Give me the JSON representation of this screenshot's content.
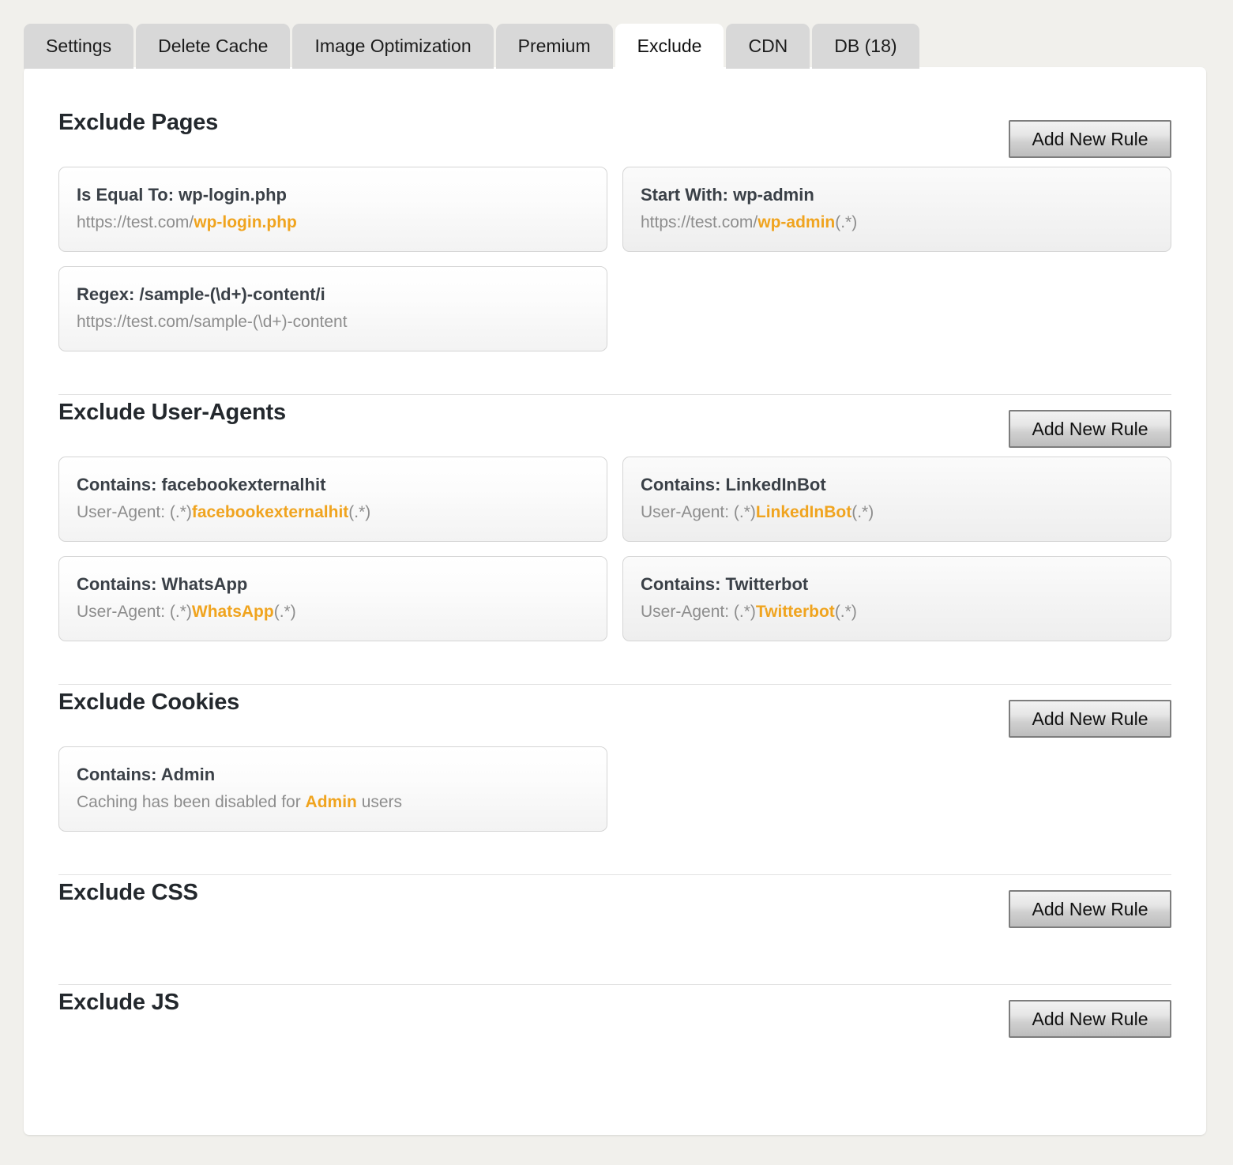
{
  "tabs": [
    {
      "label": "Settings",
      "active": false
    },
    {
      "label": "Delete Cache",
      "active": false
    },
    {
      "label": "Image Optimization",
      "active": false
    },
    {
      "label": "Premium",
      "active": false
    },
    {
      "label": "Exclude",
      "active": true
    },
    {
      "label": "CDN",
      "active": false
    },
    {
      "label": "DB (18)",
      "active": false
    }
  ],
  "colors": {
    "highlight": "#f0a41f",
    "heading": "#23282d",
    "card_title": "#3a4047",
    "card_sub": "#8d8d8d",
    "page_bg": "#f1f0ec",
    "panel_bg": "#ffffff",
    "tab_bg": "#d8d8d8"
  },
  "add_rule_label": "Add New Rule",
  "sections": [
    {
      "id": "exclude-pages",
      "title": "Exclude Pages",
      "button": "Add New Rule",
      "rules": [
        {
          "title": "Is Equal To: wp-login.php",
          "sub_pre": "https://test.com/",
          "sub_hl": "wp-login.php",
          "sub_post": "",
          "shaded": false
        },
        {
          "title": "Start With: wp-admin",
          "sub_pre": "https://test.com/",
          "sub_hl": "wp-admin",
          "sub_post": "(.*)",
          "shaded": true
        },
        {
          "title": "Regex: /sample-(\\d+)-content/i",
          "sub_pre": "https://test.com/sample-(\\d+)-content",
          "sub_hl": "",
          "sub_post": "",
          "shaded": false
        }
      ]
    },
    {
      "id": "exclude-user-agents",
      "title": "Exclude User-Agents",
      "button": "Add New Rule",
      "rules": [
        {
          "title": "Contains: facebookexternalhit",
          "sub_pre": "User-Agent: (.*)",
          "sub_hl": "facebookexternalhit",
          "sub_post": "(.*)",
          "shaded": false
        },
        {
          "title": "Contains: LinkedInBot",
          "sub_pre": "User-Agent: (.*)",
          "sub_hl": "LinkedInBot",
          "sub_post": "(.*)",
          "shaded": true
        },
        {
          "title": "Contains: WhatsApp",
          "sub_pre": "User-Agent: (.*)",
          "sub_hl": "WhatsApp",
          "sub_post": "(.*)",
          "shaded": false
        },
        {
          "title": "Contains: Twitterbot",
          "sub_pre": "User-Agent: (.*)",
          "sub_hl": "Twitterbot",
          "sub_post": "(.*)",
          "shaded": true
        }
      ]
    },
    {
      "id": "exclude-cookies",
      "title": "Exclude Cookies",
      "button": "Add New Rule",
      "rules": [
        {
          "title": "Contains: Admin",
          "sub_pre": "Caching has been disabled for ",
          "sub_hl": "Admin",
          "sub_post": " users",
          "shaded": false
        }
      ]
    },
    {
      "id": "exclude-css",
      "title": "Exclude CSS",
      "button": "Add New Rule",
      "rules": []
    },
    {
      "id": "exclude-js",
      "title": "Exclude JS",
      "button": "Add New Rule",
      "rules": []
    }
  ]
}
